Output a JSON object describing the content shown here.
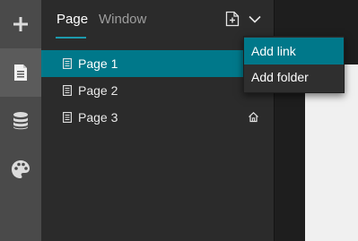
{
  "rail": {
    "items": [
      {
        "icon": "plus-icon"
      },
      {
        "icon": "page-icon",
        "active": true
      },
      {
        "icon": "database-icon"
      },
      {
        "icon": "palette-icon"
      }
    ]
  },
  "tabs": {
    "page": "Page",
    "window": "Window",
    "active": "Page"
  },
  "header": {
    "add_page_icon": "add-page-icon",
    "dropdown_icon": "chevron-down-icon"
  },
  "pages": [
    {
      "label": "Page 1",
      "selected": true
    },
    {
      "label": "Page 2",
      "selected": false
    },
    {
      "label": "Page 3",
      "selected": false,
      "home": true
    }
  ],
  "menu": {
    "items": [
      {
        "label": "Add link",
        "highlighted": true
      },
      {
        "label": "Add folder",
        "highlighted": false
      }
    ]
  },
  "colors": {
    "accent": "#00788a",
    "tab_underline": "#1d9aad",
    "panel_bg": "#2b2b2b",
    "rail_bg": "#4a4a4a"
  }
}
